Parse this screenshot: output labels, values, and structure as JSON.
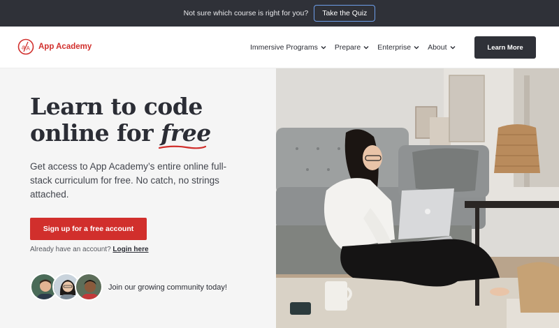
{
  "banner": {
    "text": "Not sure which course is right for you?",
    "cta": "Take the Quiz"
  },
  "nav": {
    "brand": "App Academy",
    "links": [
      {
        "label": "Immersive Programs",
        "icon": "chevron-down-icon"
      },
      {
        "label": "Prepare",
        "icon": "chevron-down-icon"
      },
      {
        "label": "Enterprise",
        "icon": "chevron-down-icon"
      },
      {
        "label": "About",
        "icon": "chevron-down-icon"
      }
    ],
    "cta": "Learn More"
  },
  "hero": {
    "headline_line1": "Learn to code",
    "headline_line2_prefix": "online for ",
    "headline_emphasis": "free",
    "subtext": "Get access to App Academy’s entire online full-stack curriculum for free. No catch, no strings attached.",
    "signup_label": "Sign up for a free account",
    "login_prompt": "Already have an account?",
    "login_link": "Login here",
    "community_text": "Join our growing community today!"
  },
  "colors": {
    "brand_red": "#d12f2c",
    "dark": "#2f3138",
    "quiz_border": "#6d9eea"
  }
}
